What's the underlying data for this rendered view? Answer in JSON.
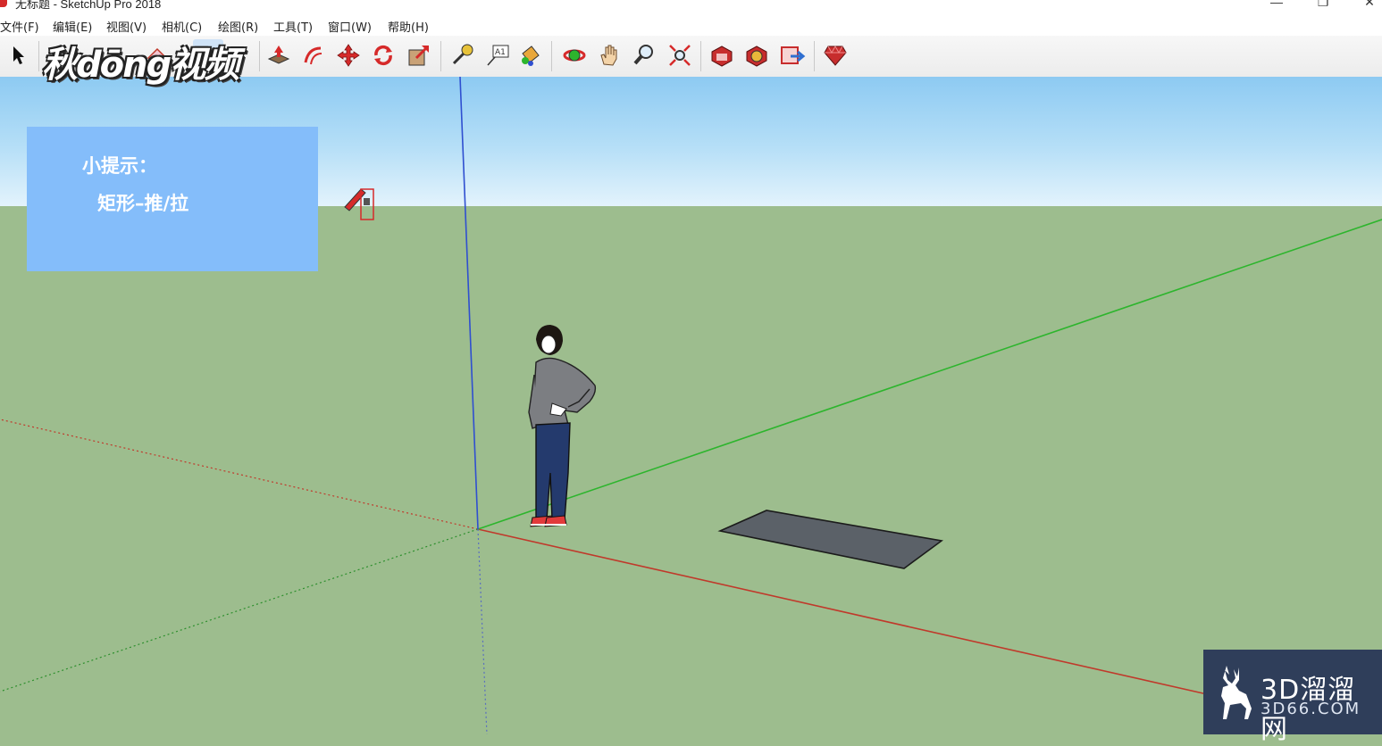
{
  "window": {
    "title": "无标题 - SketchUp Pro 2018",
    "controls": {
      "minimize": "—",
      "restore": "❐",
      "close": "✕"
    }
  },
  "menubar": {
    "items": [
      "文件(F)",
      "编辑(E)",
      "视图(V)",
      "相机(C)",
      "绘图(R)",
      "工具(T)",
      "窗口(W)",
      "帮助(H)"
    ]
  },
  "toolbar": {
    "tools": [
      {
        "name": "select-tool-icon"
      },
      {
        "name": "eraser-tool-icon"
      },
      {
        "name": "rectangle-tool-icon"
      },
      {
        "name": "push-pull-tool-icon"
      },
      {
        "name": "offset-tool-icon"
      },
      {
        "name": "move-tool-icon"
      },
      {
        "name": "rotate-tool-icon"
      },
      {
        "name": "scale-tool-icon"
      },
      {
        "name": "tape-measure-tool-icon"
      },
      {
        "name": "text-tool-icon"
      },
      {
        "name": "paint-bucket-tool-icon"
      },
      {
        "name": "orbit-tool-icon"
      },
      {
        "name": "pan-tool-icon"
      },
      {
        "name": "zoom-tool-icon"
      },
      {
        "name": "zoom-extents-tool-icon"
      },
      {
        "name": "3d-warehouse-icon"
      },
      {
        "name": "extension-warehouse-icon"
      },
      {
        "name": "send-to-layout-icon"
      },
      {
        "name": "ruby-console-icon"
      }
    ]
  },
  "watermark": {
    "logo_text": "秋dōng视频"
  },
  "tip": {
    "title": "小提示：",
    "body": "矩形–推/拉"
  },
  "brand": {
    "name": "3D溜溜网",
    "url": "3D66.COM"
  },
  "colors": {
    "sky_top": "#8dcaf2",
    "ground": "#9dbd8e",
    "axis_red": "#c0392b",
    "axis_green": "#2db52d",
    "axis_blue": "#2f4fd0",
    "rectangle_face": "#5b6168",
    "tip_box": "#84bdfa"
  }
}
